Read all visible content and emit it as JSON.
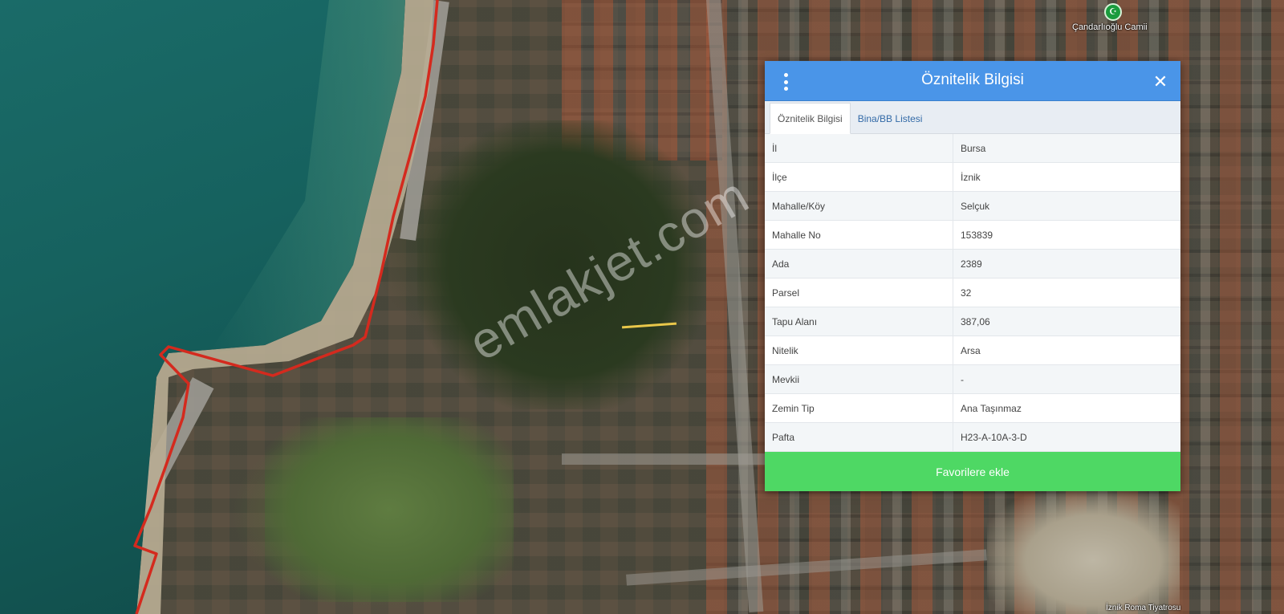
{
  "map": {
    "watermark": "emlakjet.com",
    "poi_mosque": "Çandarlıoğlu Camii",
    "poi_theatre": "İznik Roma Tiyatrosu"
  },
  "panel": {
    "title": "Öznitelik Bilgisi",
    "tabs": [
      {
        "label": "Öznitelik Bilgisi",
        "active": true
      },
      {
        "label": "Bina/BB Listesi",
        "active": false
      }
    ],
    "rows": [
      {
        "key": "İl",
        "value": "Bursa"
      },
      {
        "key": "İlçe",
        "value": "İznik"
      },
      {
        "key": "Mahalle/Köy",
        "value": "Selçuk"
      },
      {
        "key": "Mahalle No",
        "value": "153839"
      },
      {
        "key": "Ada",
        "value": "2389"
      },
      {
        "key": "Parsel",
        "value": "32"
      },
      {
        "key": "Tapu Alanı",
        "value": "387,06"
      },
      {
        "key": "Nitelik",
        "value": "Arsa"
      },
      {
        "key": "Mevkii",
        "value": "-"
      },
      {
        "key": "Zemin Tip",
        "value": "Ana Taşınmaz"
      },
      {
        "key": "Pafta",
        "value": "H23-A-10A-3-D"
      }
    ],
    "favorite_button": "Favorilere ekle",
    "header_color": "#4a95e8",
    "button_color": "#4ed864"
  },
  "icons": {
    "menu": "vertical-dots-icon",
    "close": "close-icon",
    "mosque": "mosque-pin-icon"
  },
  "colors": {
    "boundary_line": "#d42a1e",
    "parcel_line": "#e9c74a"
  }
}
